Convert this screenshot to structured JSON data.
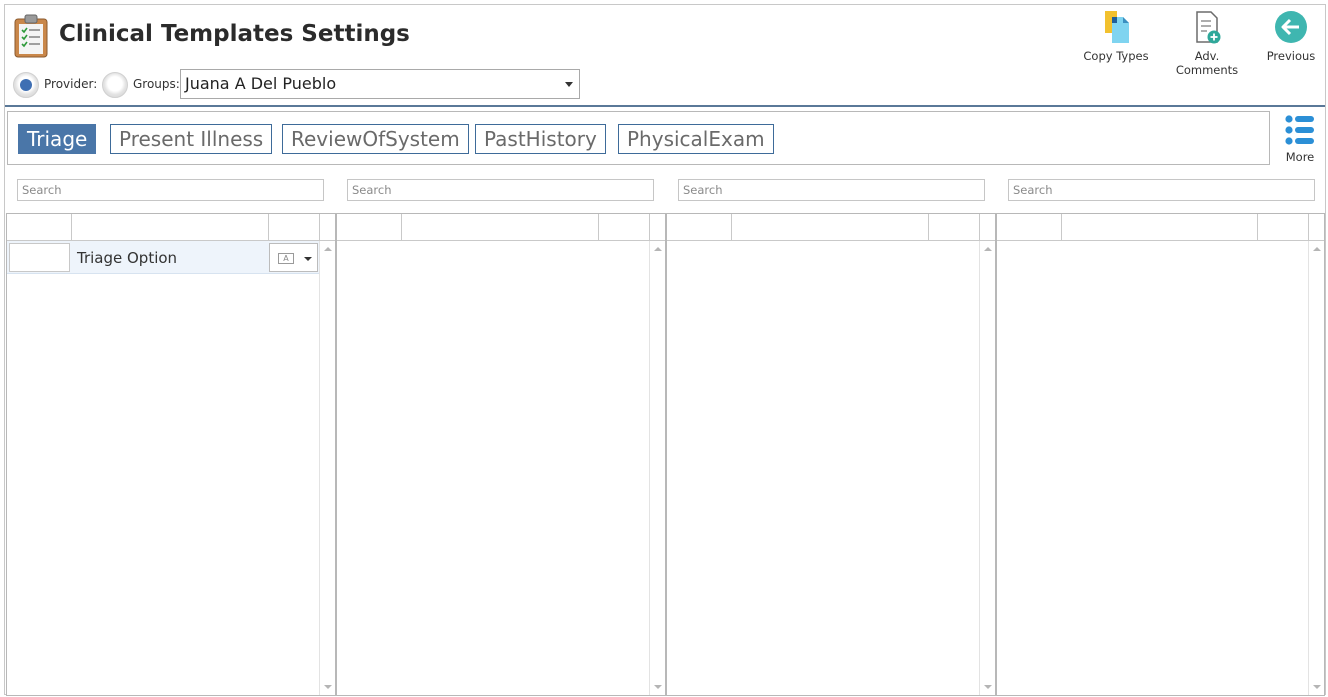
{
  "header": {
    "title": "Clinical Templates Settings",
    "provider_label": "Provider:",
    "groups_label": "Groups:",
    "selected_provider": "Juana A Del Pueblo"
  },
  "toolbar": {
    "copy_types": "Copy Types",
    "adv_comments": "Adv. Comments",
    "previous": "Previous"
  },
  "tabs": [
    {
      "label": "Triage",
      "active": true
    },
    {
      "label": "Present Illness",
      "active": false
    },
    {
      "label": "ReviewOfSystem",
      "active": false
    },
    {
      "label": "PastHistory",
      "active": false
    },
    {
      "label": "PhysicalExam",
      "active": false
    }
  ],
  "more_label": "More",
  "search_placeholder": "Search",
  "grids": [
    {
      "rows": [
        {
          "label": "Triage Option"
        }
      ]
    },
    {
      "rows": []
    },
    {
      "rows": []
    },
    {
      "rows": []
    }
  ],
  "colors": {
    "accent": "#4a76a8",
    "header_rule": "#5a7898",
    "row_highlight": "#eef4fb"
  }
}
